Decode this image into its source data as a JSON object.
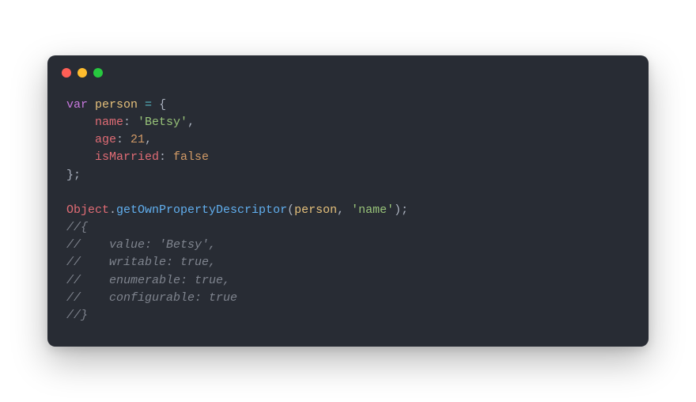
{
  "window": {
    "controls": [
      "close",
      "minimize",
      "zoom"
    ]
  },
  "code": {
    "lines": [
      {
        "tokens": [
          {
            "t": "var ",
            "c": "kw"
          },
          {
            "t": "person",
            "c": "var"
          },
          {
            "t": " ",
            "c": "punct"
          },
          {
            "t": "=",
            "c": "op"
          },
          {
            "t": " {",
            "c": "punct"
          }
        ]
      },
      {
        "tokens": [
          {
            "t": "    ",
            "c": "punct"
          },
          {
            "t": "name",
            "c": "prop"
          },
          {
            "t": ": ",
            "c": "punct"
          },
          {
            "t": "'Betsy'",
            "c": "str"
          },
          {
            "t": ",",
            "c": "punct"
          }
        ]
      },
      {
        "tokens": [
          {
            "t": "    ",
            "c": "punct"
          },
          {
            "t": "age",
            "c": "prop"
          },
          {
            "t": ": ",
            "c": "punct"
          },
          {
            "t": "21",
            "c": "num"
          },
          {
            "t": ",",
            "c": "punct"
          }
        ]
      },
      {
        "tokens": [
          {
            "t": "    ",
            "c": "punct"
          },
          {
            "t": "isMarried",
            "c": "prop"
          },
          {
            "t": ": ",
            "c": "punct"
          },
          {
            "t": "false",
            "c": "bool"
          }
        ]
      },
      {
        "tokens": [
          {
            "t": "};",
            "c": "punct"
          }
        ]
      },
      {
        "tokens": [
          {
            "t": "",
            "c": "punct"
          }
        ]
      },
      {
        "tokens": [
          {
            "t": "Object",
            "c": "builtin"
          },
          {
            "t": ".",
            "c": "punct"
          },
          {
            "t": "getOwnPropertyDescriptor",
            "c": "fn"
          },
          {
            "t": "(",
            "c": "punct"
          },
          {
            "t": "person",
            "c": "var"
          },
          {
            "t": ", ",
            "c": "punct"
          },
          {
            "t": "'name'",
            "c": "str"
          },
          {
            "t": ");",
            "c": "punct"
          }
        ]
      },
      {
        "tokens": [
          {
            "t": "//{",
            "c": "comment"
          }
        ]
      },
      {
        "tokens": [
          {
            "t": "//    value: 'Betsy',",
            "c": "comment"
          }
        ]
      },
      {
        "tokens": [
          {
            "t": "//    writable: true,",
            "c": "comment"
          }
        ]
      },
      {
        "tokens": [
          {
            "t": "//    enumerable: true,",
            "c": "comment"
          }
        ]
      },
      {
        "tokens": [
          {
            "t": "//    configurable: true",
            "c": "comment"
          }
        ]
      },
      {
        "tokens": [
          {
            "t": "//}",
            "c": "comment"
          }
        ]
      }
    ]
  }
}
